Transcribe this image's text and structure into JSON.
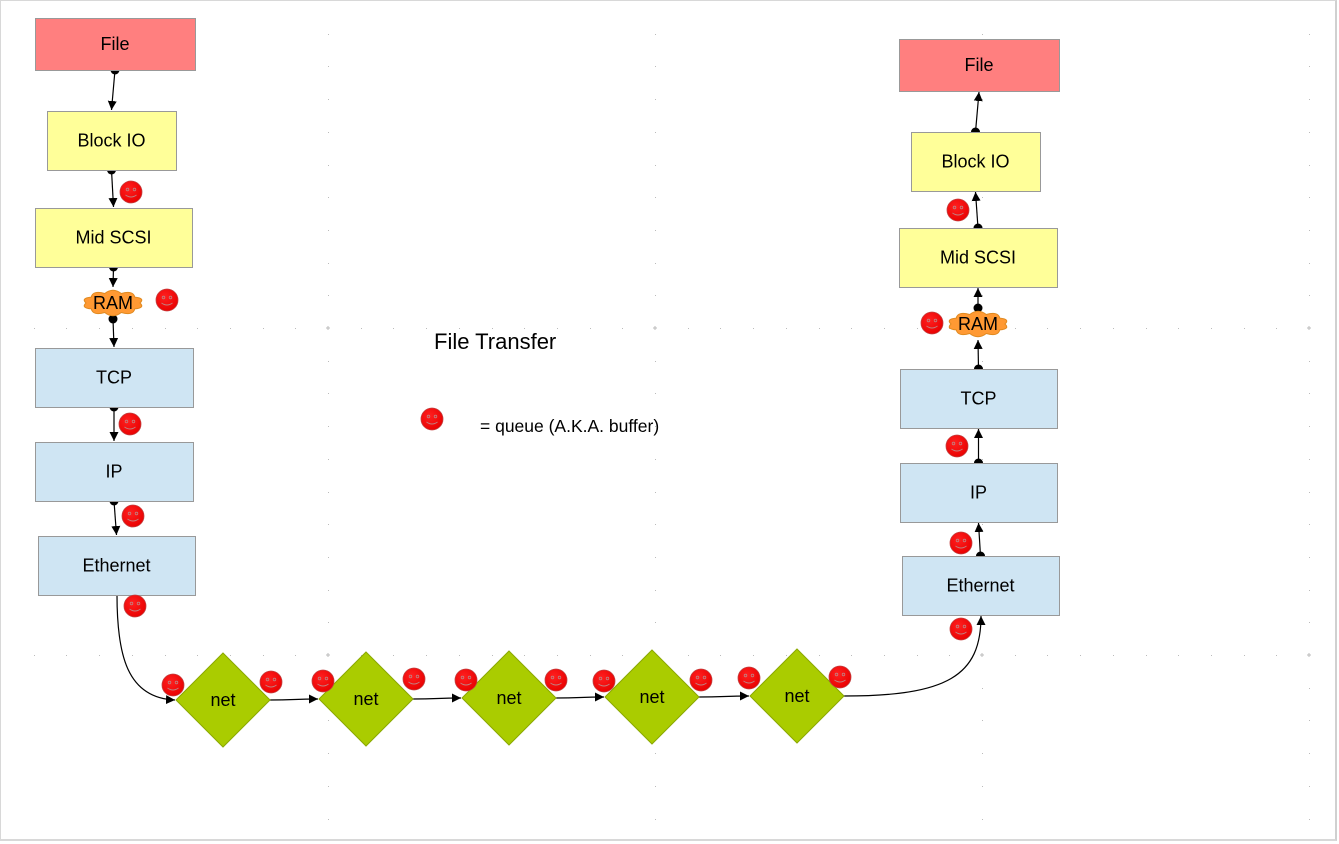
{
  "diagram": {
    "title": "File Transfer",
    "legend": {
      "icon": "smiley-queue-icon",
      "label": "= queue (A.K.A. buffer)"
    },
    "colors": {
      "file": "#ff7f7f",
      "block": "#ffff99",
      "network_layer": "#cfe5f3",
      "ram": "#ff9933",
      "net": "#aacc00",
      "queue": "#ff0000",
      "border": "#999999",
      "edge": "#000000",
      "grid": "#bbbbbb"
    },
    "sender_stack": [
      {
        "id": "s-file",
        "label": "File",
        "kind": "file"
      },
      {
        "id": "s-blockio",
        "label": "Block IO",
        "kind": "block"
      },
      {
        "id": "s-midscsi",
        "label": "Mid SCSI",
        "kind": "block"
      },
      {
        "id": "s-ram",
        "label": "RAM",
        "kind": "ram"
      },
      {
        "id": "s-tcp",
        "label": "TCP",
        "kind": "network_layer"
      },
      {
        "id": "s-ip",
        "label": "IP",
        "kind": "network_layer"
      },
      {
        "id": "s-ethernet",
        "label": "Ethernet",
        "kind": "network_layer"
      }
    ],
    "receiver_stack": [
      {
        "id": "r-file",
        "label": "File",
        "kind": "file"
      },
      {
        "id": "r-blockio",
        "label": "Block IO",
        "kind": "block"
      },
      {
        "id": "r-midscsi",
        "label": "Mid SCSI",
        "kind": "block"
      },
      {
        "id": "r-ram",
        "label": "RAM",
        "kind": "ram"
      },
      {
        "id": "r-tcp",
        "label": "TCP",
        "kind": "network_layer"
      },
      {
        "id": "r-ip",
        "label": "IP",
        "kind": "network_layer"
      },
      {
        "id": "r-ethernet",
        "label": "Ethernet",
        "kind": "network_layer"
      }
    ],
    "network_hops": [
      {
        "id": "net-1",
        "label": "net"
      },
      {
        "id": "net-2",
        "label": "net"
      },
      {
        "id": "net-3",
        "label": "net"
      },
      {
        "id": "net-4",
        "label": "net"
      },
      {
        "id": "net-5",
        "label": "net"
      }
    ],
    "edges": [
      {
        "from": "s-file",
        "to": "s-blockio",
        "queue": false
      },
      {
        "from": "s-blockio",
        "to": "s-midscsi",
        "queue": true
      },
      {
        "from": "s-midscsi",
        "to": "s-ram",
        "queue": false
      },
      {
        "from": "s-ram",
        "to": "s-tcp",
        "queue": true
      },
      {
        "from": "s-tcp",
        "to": "s-ip",
        "queue": true
      },
      {
        "from": "s-ip",
        "to": "s-ethernet",
        "queue": true
      },
      {
        "from": "s-ethernet",
        "to": "net-1",
        "queue": true
      },
      {
        "from": "net-1",
        "to": "net-2",
        "queue": true
      },
      {
        "from": "net-2",
        "to": "net-3",
        "queue": true
      },
      {
        "from": "net-3",
        "to": "net-4",
        "queue": true
      },
      {
        "from": "net-4",
        "to": "net-5",
        "queue": true
      },
      {
        "from": "net-5",
        "to": "r-ethernet",
        "queue": true
      },
      {
        "from": "r-ethernet",
        "to": "r-ip",
        "queue": true
      },
      {
        "from": "r-ip",
        "to": "r-tcp",
        "queue": true
      },
      {
        "from": "r-tcp",
        "to": "r-ram",
        "queue": false
      },
      {
        "from": "r-ram",
        "to": "r-midscsi",
        "queue": true
      },
      {
        "from": "r-midscsi",
        "to": "r-blockio",
        "queue": true
      },
      {
        "from": "r-blockio",
        "to": "r-file",
        "queue": false
      }
    ]
  }
}
